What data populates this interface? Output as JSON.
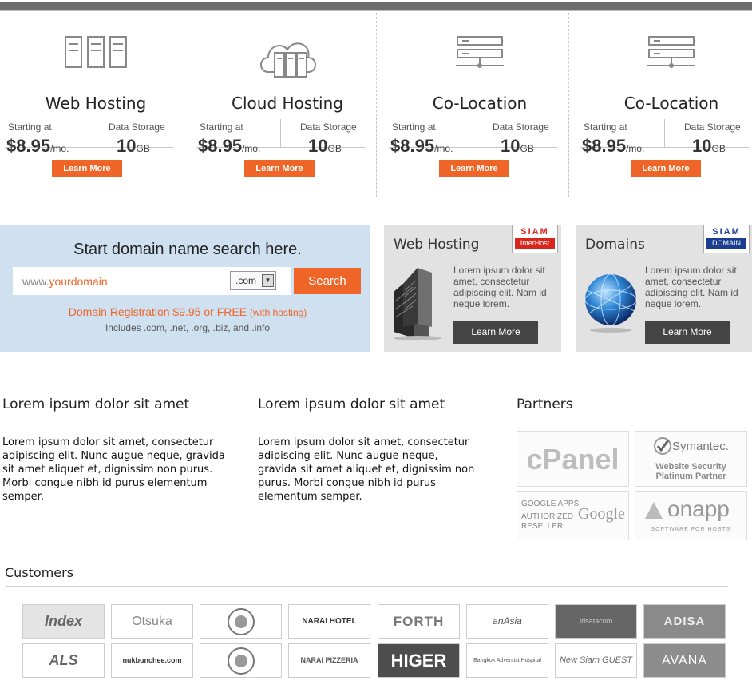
{
  "plans": [
    {
      "name": "Web Hosting",
      "starting_label": "Starting at",
      "price": "$8.95",
      "per": "/mo.",
      "storage_label": "Data Storage",
      "storage": "10",
      "unit": "GB",
      "button": "Learn More",
      "icon": "servers-icon"
    },
    {
      "name": "Cloud Hosting",
      "starting_label": "Starting at",
      "price": "$8.95",
      "per": "/mo.",
      "storage_label": "Data Storage",
      "storage": "10",
      "unit": "GB",
      "button": "Learn More",
      "icon": "cloud-server-icon"
    },
    {
      "name": "Co-Location",
      "starting_label": "Starting at",
      "price": "$8.95",
      "per": "/mo.",
      "storage_label": "Data Storage",
      "storage": "10",
      "unit": "GB",
      "button": "Learn More",
      "icon": "rack-icon"
    },
    {
      "name": "Co-Location",
      "starting_label": "Starting at",
      "price": "$8.95",
      "per": "/mo.",
      "storage_label": "Data Storage",
      "storage": "10",
      "unit": "GB",
      "button": "Learn More",
      "icon": "rack-icon"
    }
  ],
  "domain_search": {
    "heading": "Start domain name search here.",
    "placeholder_prefix": "www.",
    "placeholder_domain": "yourdomain",
    "tld": ".com",
    "button": "Search",
    "registration": "Domain Registration $9.95 or FREE",
    "registration_note": "(with hosting)",
    "includes": "Includes .com, .net, .org, .biz, and .info"
  },
  "promos": [
    {
      "title": "Web Hosting",
      "badge_top": "SIAM",
      "badge_bottom": "InterHost",
      "text": "Lorem ipsum dolor sit amet, consectetur adipiscing elit. Nam id neque lorem.",
      "button": "Learn More"
    },
    {
      "title": "Domains",
      "badge_top": "SIAM",
      "badge_bottom": "DOMAIN",
      "text": "Lorem ipsum dolor sit amet, consectetur adipiscing elit. Nam id neque lorem.",
      "button": "Learn More"
    }
  ],
  "articles": [
    {
      "title": "Lorem ipsum dolor sit amet",
      "body": "Lorem ipsum dolor sit amet, consectetur adipiscing elit. Nunc augue neque, gravida sit amet aliquet et, dignissim non purus. Morbi congue nibh id purus elementum semper."
    },
    {
      "title": "Lorem ipsum dolor sit amet",
      "body": "Lorem ipsum dolor sit amet, consectetur adipiscing elit. Nunc augue neque, gravida sit amet aliquet et, dignissim non purus. Morbi congue nibh id purus elementum semper."
    }
  ],
  "partners": {
    "title": "Partners",
    "cpanel": "cPanel",
    "symantec": "Symantec.",
    "symantec_sub1": "Website Security",
    "symantec_sub2": "Platinum Partner",
    "google_l1": "GOOGLE APPS",
    "google_l2": "AUTHORIZED",
    "google_l3": "RESELLER",
    "google": "Google",
    "onapp": "onapp",
    "onapp_sub": "SOFTWARE FOR HOSTS"
  },
  "customers": {
    "title": "Customers",
    "logos": [
      "Index",
      "Otsuka",
      "",
      "NARAI HOTEL",
      "FORTH",
      "anAsia",
      "Irisatacom",
      "ADISA",
      "ALS",
      "nukbunchee.com",
      "",
      "NARAI PIZZERIA",
      "HIGER",
      "Bangkok Adventist Hospital",
      "New Siam GUEST HOUSE",
      "AVANA"
    ]
  },
  "colors": {
    "accent": "#ef6527",
    "search_bg": "#cfe0f1",
    "promo_bg": "#e2e2e2",
    "dark_button": "#444444"
  }
}
